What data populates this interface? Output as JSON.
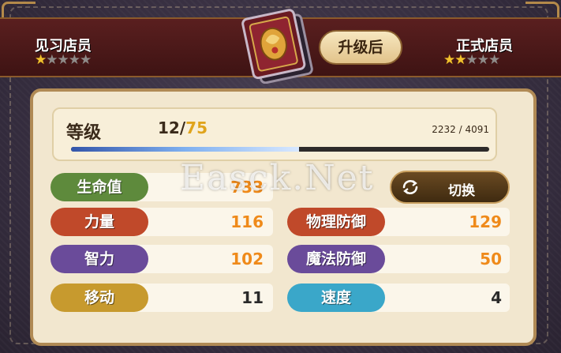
{
  "header": {
    "current_rank": "见习店员",
    "current_stars": 1,
    "next_rank": "正式店员",
    "next_stars": 2,
    "max_stars": 5,
    "upgrade_label": "升级后"
  },
  "level": {
    "label": "等级",
    "current": "12",
    "separator": "/",
    "max": "75",
    "exp_text": "2232 / 4091",
    "exp_current": 2232,
    "exp_total": 4091
  },
  "stats": {
    "hp": {
      "label": "生命值",
      "value": "733",
      "color": "#5e8a3c"
    },
    "str": {
      "label": "力量",
      "value": "116",
      "color": "#c0492a"
    },
    "int": {
      "label": "智力",
      "value": "102",
      "color": "#6a4b9a"
    },
    "move": {
      "label": "移动",
      "value": "11",
      "color": "#c79a2e"
    },
    "pdef": {
      "label": "物理防御",
      "value": "129",
      "color": "#c0492a"
    },
    "mdef": {
      "label": "魔法防御",
      "value": "50",
      "color": "#6a4b9a"
    },
    "spd": {
      "label": "速度",
      "value": "4",
      "color": "#3aa7c9"
    }
  },
  "switch_label": "切换",
  "watermark": "Easck.Net",
  "colors": {
    "value_orange": "#ef8a1a",
    "value_dark": "#2a2a2a",
    "star_on": "#f2c12e"
  }
}
